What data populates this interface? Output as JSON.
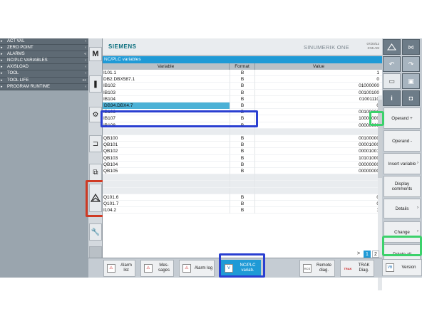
{
  "nav": {
    "items": [
      {
        "label": "ACT VAL",
        "chev": "‹"
      },
      {
        "label": "ZERO POINT",
        "chev": "‹"
      },
      {
        "label": "ALARMS",
        "chev": "«"
      },
      {
        "label": "NC/PLC VARIABLES",
        "chev": "‹"
      },
      {
        "label": "AXISLOAD",
        "chev": "‹"
      },
      {
        "label": "TOOL",
        "chev": "‹"
      },
      {
        "label": "TOOL LIFE",
        "chev": "««"
      },
      {
        "label": "PROGRAM RUNTIME",
        "chev": "‹"
      }
    ]
  },
  "header": {
    "brand": "SIEMENS",
    "product": "SINUMERIK ONE",
    "date": "07/20/12",
    "time": "3:55 AM"
  },
  "title": "NC/PLC variables",
  "table": {
    "columns": [
      "Variable",
      "Format",
      "Value"
    ],
    "rows": [
      {
        "variable": "I101.1",
        "format": "B",
        "value": "1"
      },
      {
        "variable": "DB2.DBX587.1",
        "format": "B",
        "value": "0"
      },
      {
        "variable": "IB102",
        "format": "B",
        "value": "01000000"
      },
      {
        "variable": "IB103",
        "format": "B",
        "value": "00100100"
      },
      {
        "variable": "IB104",
        "format": "B",
        "value": "01001110"
      },
      {
        "variable": "DB34.DBX4.7",
        "format": "B",
        "value": "0"
      },
      {
        "variable": "IB106",
        "format": "B",
        "value": "00100000"
      },
      {
        "variable": "IB107",
        "format": "B",
        "value": "10000000"
      },
      {
        "variable": "IB108",
        "format": "B",
        "value": "00000000"
      },
      {
        "variable": "",
        "format": "",
        "value": ""
      },
      {
        "variable": "QB100",
        "format": "B",
        "value": "00100000"
      },
      {
        "variable": "QB101",
        "format": "B",
        "value": "00001000"
      },
      {
        "variable": "QB102",
        "format": "B",
        "value": "00001001"
      },
      {
        "variable": "QB103",
        "format": "B",
        "value": "10101000"
      },
      {
        "variable": "QB104",
        "format": "B",
        "value": "00000000"
      },
      {
        "variable": "QB105",
        "format": "B",
        "value": "00000000"
      },
      {
        "variable": "",
        "format": "",
        "value": ""
      },
      {
        "variable": "",
        "format": "",
        "value": ""
      },
      {
        "variable": "",
        "format": "",
        "value": ""
      },
      {
        "variable": "Q101.6",
        "format": "B",
        "value": "0"
      },
      {
        "variable": "Q101.7",
        "format": "B",
        "value": "0"
      },
      {
        "variable": "I104.2",
        "format": "B",
        "value": "1"
      }
    ]
  },
  "pagination": {
    "next": ">",
    "page1": "1",
    "page2": "2"
  },
  "right_softkeys": [
    {
      "label": "Operand +"
    },
    {
      "label": "Operand -"
    },
    {
      "label": "Insert variable"
    },
    {
      "label": "Display comments"
    },
    {
      "label": "Details"
    },
    {
      "label": "Change"
    },
    {
      "label": "Delete all"
    }
  ],
  "bottom_softkeys": [
    {
      "label": "Alarm list"
    },
    {
      "label": "Mes- sages"
    },
    {
      "label": "Alarm log"
    },
    {
      "label": "NC/PLC variab."
    },
    {
      "label": "Remote diag."
    },
    {
      "label": "TRAK Diag."
    },
    {
      "label": "Version"
    }
  ],
  "icons": {
    "trak_logo": "TRAK",
    "rcs": "RCS",
    "vb": "VB",
    "v": "V"
  },
  "colors": {
    "accent": "#1f9ad6",
    "highlight_blue": "#2a3fd1",
    "highlight_green": "#3bd16b",
    "highlight_red": "#cf3a24"
  }
}
